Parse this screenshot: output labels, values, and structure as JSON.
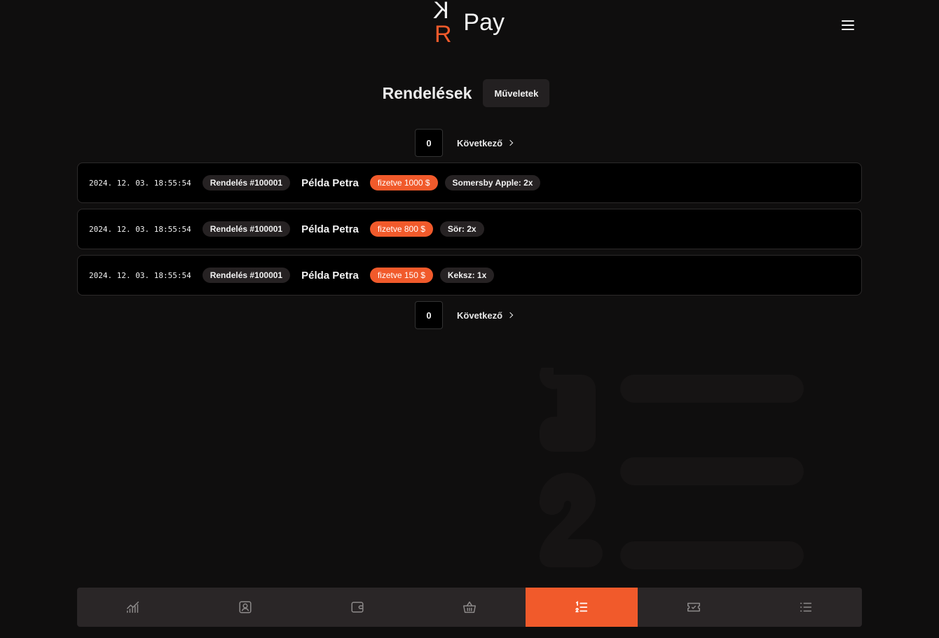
{
  "brand": {
    "logo_kr": "KR",
    "logo_pay": "Pay",
    "accent": "#f15a2b"
  },
  "header": {
    "menu_icon": "hamburger-menu-icon"
  },
  "page": {
    "title": "Rendelések",
    "actions_label": "Műveletek"
  },
  "pager": {
    "page_number": "0",
    "next_label": "Következő"
  },
  "orders": [
    {
      "date": "2024. 12. 03. 18:55:54",
      "order_id": "Rendelés #100001",
      "customer": "Példa Petra",
      "status": "fizetve 1000 $",
      "items": "Somersby Apple: 2x"
    },
    {
      "date": "2024. 12. 03. 18:55:54",
      "order_id": "Rendelés #100001",
      "customer": "Példa Petra",
      "status": "fizetve 800 $",
      "items": "Sör: 2x"
    },
    {
      "date": "2024. 12. 03. 18:55:54",
      "order_id": "Rendelés #100001",
      "customer": "Példa Petra",
      "status": "fizetve 150 $",
      "items": "Keksz: 1x"
    }
  ],
  "bottom_nav": [
    {
      "icon": "chart-icon",
      "active": false
    },
    {
      "icon": "user-card-icon",
      "active": false
    },
    {
      "icon": "wallet-icon",
      "active": false
    },
    {
      "icon": "basket-icon",
      "active": false
    },
    {
      "icon": "ordered-list-icon",
      "active": true
    },
    {
      "icon": "ticket-icon",
      "active": false
    },
    {
      "icon": "list-icon",
      "active": false
    }
  ]
}
